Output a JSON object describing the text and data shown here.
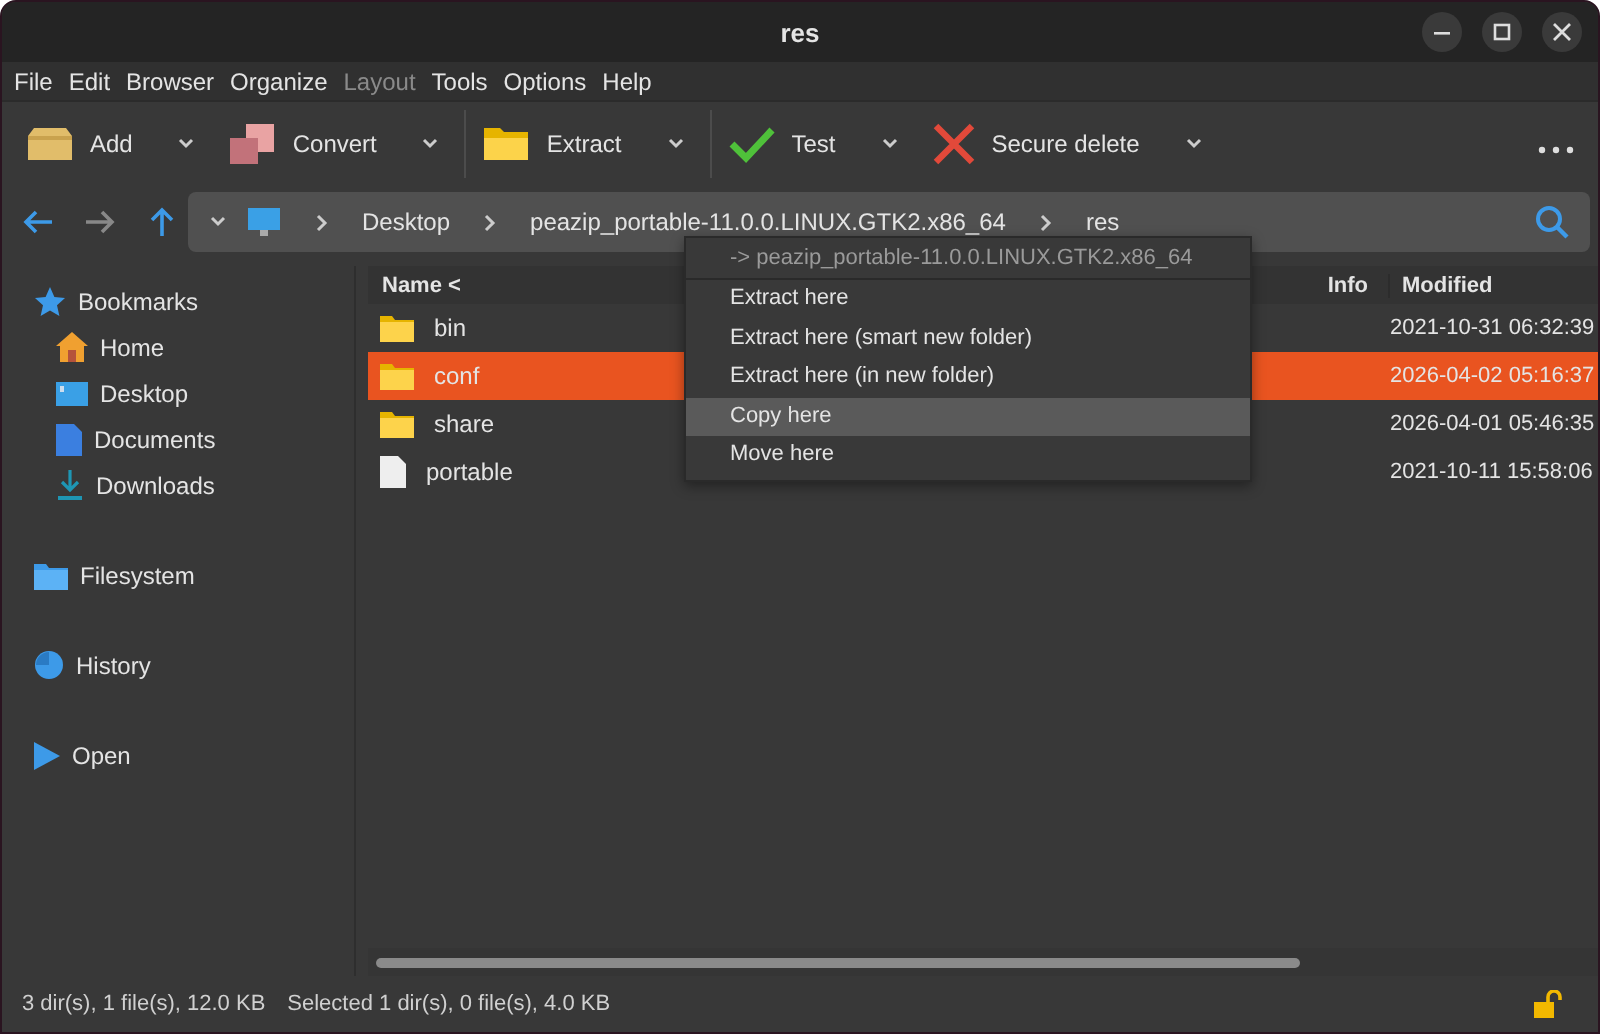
{
  "window": {
    "title": "res"
  },
  "menu": [
    "File",
    "Edit",
    "Browser",
    "Organize",
    "Layout",
    "Tools",
    "Options",
    "Help"
  ],
  "menu_disabled": [
    false,
    false,
    false,
    false,
    true,
    false,
    false,
    false
  ],
  "toolbar": [
    {
      "label": "Add",
      "kind": "add"
    },
    {
      "label": "Convert",
      "kind": "convert"
    },
    {
      "label": "Extract",
      "kind": "extract"
    },
    {
      "label": "Test",
      "kind": "test"
    },
    {
      "label": "Secure delete",
      "kind": "delete"
    }
  ],
  "path": [
    "Desktop",
    "peazip_portable-11.0.0.LINUX.GTK2.x86_64",
    "res"
  ],
  "sidebar": [
    {
      "label": "Bookmarks",
      "kind": "star",
      "children": [
        {
          "label": "Home",
          "kind": "home"
        },
        {
          "label": "Desktop",
          "kind": "desktop"
        },
        {
          "label": "Documents",
          "kind": "document"
        },
        {
          "label": "Downloads",
          "kind": "download"
        }
      ]
    },
    {
      "label": "Filesystem",
      "kind": "folder"
    },
    {
      "label": "History",
      "kind": "history"
    },
    {
      "label": "Open",
      "kind": "play"
    }
  ],
  "table": {
    "columns": [
      "Name <",
      "Info",
      "Modified"
    ],
    "rows": [
      {
        "name": "bin",
        "kind": "folder",
        "modified": "2021-10-31 06:32:39",
        "selected": false
      },
      {
        "name": "conf",
        "kind": "folder",
        "modified": "2026-04-02 05:16:37",
        "selected": true
      },
      {
        "name": "share",
        "kind": "folder",
        "modified": "2026-04-01 05:46:35",
        "selected": false
      },
      {
        "name": "portable",
        "kind": "file",
        "modified": "2021-10-11 15:58:06",
        "selected": false
      }
    ]
  },
  "context_menu": {
    "header": "-> peazip_portable-11.0.0.LINUX.GTK2.x86_64",
    "items": [
      {
        "label": "Extract here",
        "selected": false
      },
      {
        "label": "Extract here (smart new folder)",
        "selected": false
      },
      {
        "label": "Extract here (in new folder)",
        "selected": false
      },
      {
        "label": "Copy here",
        "selected": true
      },
      {
        "label": "Move here",
        "selected": false
      }
    ]
  },
  "status_bar": [
    "3 dir(s), 1 file(s), 12.0 KB",
    "Selected 1 dir(s), 0 file(s), 4.0 KB"
  ]
}
